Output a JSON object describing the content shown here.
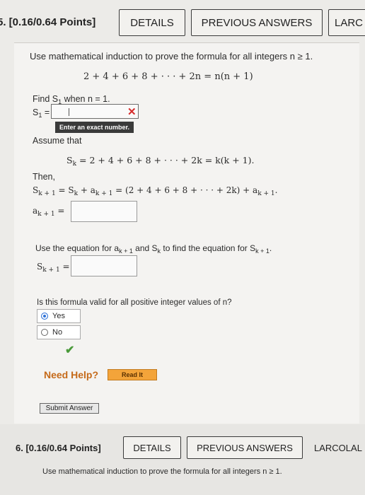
{
  "q5": {
    "title": "5. [0.16/0.64 Points]",
    "details_label": "DETAILS",
    "prev_label": "PREVIOUS ANSWERS",
    "larc_label": "LARC"
  },
  "body": {
    "prompt": "Use mathematical induction to prove the formula for all integers n ≥ 1.",
    "formula": "2 + 4 + 6 + 8 + · · · + 2n = n(n + 1)",
    "find_label": "Find S",
    "find_suffix": " when n = 1.",
    "s1_label": "S",
    "s1_sub": "1",
    "s1_value": "",
    "tooltip": "Enter an exact number.",
    "assume": "Assume that",
    "sk_eq": "S",
    "sk_formula": " = 2 + 4 + 6 + 8 + · · · + 2k = k(k + 1).",
    "then": "Then,",
    "skp1_eq": "S",
    "skp1_rest": " = S",
    "skp1_rest2": " + a",
    "skp1_rest3": " = (2 + 4 + 6 + 8 + · · · + 2k) + a",
    "akp1_label": "a",
    "use_eq": "Use the equation for a",
    "use_eq2": " and S",
    "use_eq3": " to find the equation for S",
    "skp1_label": "S",
    "valid_q": "Is this formula valid for all positive integer values of n?",
    "opt_yes": "Yes",
    "opt_no": "No",
    "need_help": "Need Help?",
    "read_it": "Read It",
    "submit": "Submit Answer"
  },
  "q6": {
    "title": "6. [0.16/0.64 Points]",
    "details_label": "DETAILS",
    "prev_label": "PREVIOUS ANSWERS",
    "larc_label": "LARCOLAL",
    "prompt": "Use mathematical induction to prove the formula for all integers n ≥ 1."
  },
  "colors": {
    "accent_blue": "#2f72d8",
    "error_red": "#d62c2c",
    "check_green": "#4a9a3a",
    "help_orange": "#c56a1a",
    "read_it_bg": "#f3a43a"
  }
}
